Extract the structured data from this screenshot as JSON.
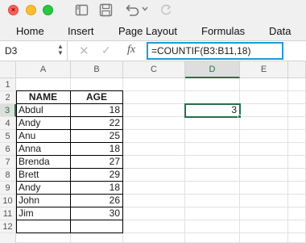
{
  "window": {
    "controls": [
      "close",
      "minimize",
      "zoom"
    ],
    "close_glyph": "×",
    "toolbar_icons": [
      "sidebar-icon",
      "save-icon",
      "undo-icon",
      "undo-dropdown-icon",
      "redo-icon"
    ]
  },
  "ribbon": {
    "tabs": [
      "Home",
      "Insert",
      "Page Layout",
      "Formulas",
      "Data"
    ]
  },
  "formula_bar": {
    "name_box": "D3",
    "name_box_arrows": "▲▼",
    "cancel_glyph": "✕",
    "enter_glyph": "✓",
    "fx_label": "fx",
    "formula": "=COUNTIF(B3:B11,18)"
  },
  "sheet": {
    "columns": [
      "A",
      "B",
      "C",
      "D",
      "E"
    ],
    "rows": [
      "1",
      "2",
      "3",
      "4",
      "5",
      "6",
      "7",
      "8",
      "9",
      "10",
      "11",
      "12"
    ],
    "selected_cell": "D3",
    "table_header": [
      "NAME",
      "AGE"
    ],
    "table_rows": [
      [
        "Abdul",
        "18"
      ],
      [
        "Andy",
        "22"
      ],
      [
        "Anu",
        "25"
      ],
      [
        "Anna",
        "18"
      ],
      [
        "Brenda",
        "27"
      ],
      [
        "Brett",
        "29"
      ],
      [
        "Andy",
        "18"
      ],
      [
        "John",
        "26"
      ],
      [
        "Jim",
        "30"
      ]
    ],
    "d3_value": "3"
  },
  "colors": {
    "accent_selection": "#217346",
    "formula_focus": "#1e9bd7"
  }
}
